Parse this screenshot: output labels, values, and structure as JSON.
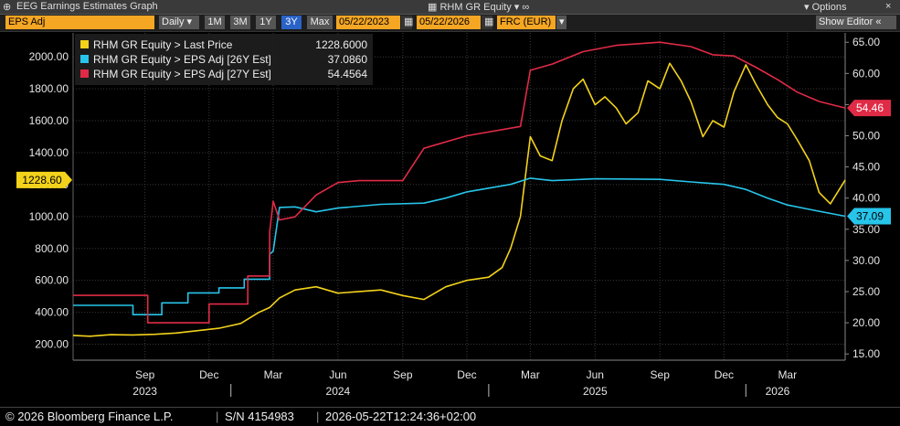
{
  "window": {
    "title": "EEG Earnings Estimates Graph",
    "security_label": "RHM GR Equity",
    "options_label": "Options",
    "close_glyph": "×"
  },
  "toolbar": {
    "field": "EPS Adj",
    "period": "Daily",
    "ranges": [
      "1M",
      "3M",
      "1Y",
      "3Y",
      "Max"
    ],
    "active_range": "3Y",
    "start_date": "05/22/2023",
    "end_date": "05/22/2026",
    "currency": "FRC (EUR)",
    "show_editor": "Show Editor"
  },
  "footer": {
    "copyright": "© 2026 Bloomberg Finance L.P.",
    "serial": "S/N 4154983",
    "timestamp": "2026-05-22T12:24:36+02:00"
  },
  "colors": {
    "price": "#f2d21b",
    "eps26": "#27c5ea",
    "eps27": "#e02b46",
    "grid": "#3a3a3a",
    "axis_text": "#e6e6e6"
  },
  "chart_data": {
    "type": "line",
    "legend": [
      {
        "label": "RHM GR Equity > Last Price",
        "value": "1228.6000",
        "color": "#f2d21b"
      },
      {
        "label": "RHM GR Equity > EPS Adj [26Y Est]",
        "value": "37.0860",
        "color": "#27c5ea"
      },
      {
        "label": "RHM GR Equity > EPS Adj [27Y Est]",
        "value": "54.4564",
        "color": "#e02b46"
      }
    ],
    "legend_position": "top-left",
    "left_axis": {
      "range": [
        100,
        2150
      ],
      "ticks": [
        "200.00",
        "400.00",
        "600.00",
        "800.00",
        "1000.00",
        "1200.00",
        "1400.00",
        "1600.00",
        "1800.00",
        "2000.00"
      ]
    },
    "right_axis": {
      "range": [
        14,
        66.5
      ],
      "ticks": [
        "15.00",
        "20.00",
        "25.00",
        "30.00",
        "35.00",
        "40.00",
        "45.00",
        "50.00",
        "55.00",
        "60.00",
        "65.00"
      ]
    },
    "x_axis": {
      "start": "2023-05-22",
      "end": "2026-05-22",
      "month_ticks": [
        {
          "date": "2023-09-01",
          "label": "Sep"
        },
        {
          "date": "2023-12-01",
          "label": "Dec"
        },
        {
          "date": "2024-03-01",
          "label": "Mar"
        },
        {
          "date": "2024-06-01",
          "label": "Jun"
        },
        {
          "date": "2024-09-01",
          "label": "Sep"
        },
        {
          "date": "2024-12-01",
          "label": "Dec"
        },
        {
          "date": "2025-03-01",
          "label": "Mar"
        },
        {
          "date": "2025-06-01",
          "label": "Jun"
        },
        {
          "date": "2025-09-01",
          "label": "Sep"
        },
        {
          "date": "2025-12-01",
          "label": "Dec"
        },
        {
          "date": "2026-03-01",
          "label": "Mar"
        }
      ],
      "year_labels": [
        {
          "date": "2023-09-01",
          "label": "2023"
        },
        {
          "date": "2024-06-01",
          "label": "2024"
        },
        {
          "date": "2025-06-01",
          "label": "2025"
        },
        {
          "date": "2026-02-15",
          "label": "2026"
        }
      ],
      "year_separators": [
        "2024-01-01",
        "2025-01-01",
        "2026-01-01"
      ]
    },
    "grid": true,
    "series": [
      {
        "name": "RHM GR Equity > Last Price",
        "axis": "left",
        "color": "#f2d21b",
        "last_label": "1228.60",
        "points": [
          [
            "2023-05-22",
            255
          ],
          [
            "2023-06-15",
            250
          ],
          [
            "2023-07-15",
            260
          ],
          [
            "2023-08-15",
            258
          ],
          [
            "2023-09-15",
            262
          ],
          [
            "2023-10-15",
            270
          ],
          [
            "2023-11-15",
            285
          ],
          [
            "2023-12-15",
            300
          ],
          [
            "2024-01-15",
            330
          ],
          [
            "2024-02-10",
            400
          ],
          [
            "2024-02-25",
            430
          ],
          [
            "2024-03-10",
            490
          ],
          [
            "2024-04-01",
            540
          ],
          [
            "2024-05-01",
            560
          ],
          [
            "2024-06-01",
            520
          ],
          [
            "2024-07-01",
            530
          ],
          [
            "2024-08-01",
            540
          ],
          [
            "2024-09-01",
            505
          ],
          [
            "2024-10-01",
            480
          ],
          [
            "2024-11-01",
            560
          ],
          [
            "2024-12-01",
            600
          ],
          [
            "2025-01-01",
            620
          ],
          [
            "2025-01-20",
            680
          ],
          [
            "2025-02-01",
            800
          ],
          [
            "2025-02-15",
            1000
          ],
          [
            "2025-03-01",
            1500
          ],
          [
            "2025-03-15",
            1380
          ],
          [
            "2025-04-01",
            1350
          ],
          [
            "2025-04-15",
            1600
          ],
          [
            "2025-05-01",
            1800
          ],
          [
            "2025-05-15",
            1860
          ],
          [
            "2025-06-01",
            1700
          ],
          [
            "2025-06-15",
            1750
          ],
          [
            "2025-07-01",
            1680
          ],
          [
            "2025-07-15",
            1580
          ],
          [
            "2025-08-01",
            1650
          ],
          [
            "2025-08-15",
            1850
          ],
          [
            "2025-09-01",
            1800
          ],
          [
            "2025-09-15",
            1960
          ],
          [
            "2025-10-01",
            1850
          ],
          [
            "2025-10-15",
            1720
          ],
          [
            "2025-11-01",
            1500
          ],
          [
            "2025-11-15",
            1600
          ],
          [
            "2025-12-01",
            1560
          ],
          [
            "2025-12-15",
            1780
          ],
          [
            "2026-01-01",
            1950
          ],
          [
            "2026-01-15",
            1830
          ],
          [
            "2026-02-01",
            1700
          ],
          [
            "2026-02-15",
            1620
          ],
          [
            "2026-03-01",
            1580
          ],
          [
            "2026-03-15",
            1480
          ],
          [
            "2026-04-01",
            1350
          ],
          [
            "2026-04-15",
            1150
          ],
          [
            "2026-05-01",
            1080
          ],
          [
            "2026-05-22",
            1228.6
          ]
        ]
      },
      {
        "name": "RHM GR Equity > EPS Adj [26Y Est]",
        "axis": "right",
        "color": "#27c5ea",
        "last_label": "37.09",
        "points": [
          [
            "2023-05-22",
            22.8
          ],
          [
            "2023-08-15",
            22.8
          ],
          [
            "2023-08-15",
            21.3
          ],
          [
            "2023-09-25",
            21.3
          ],
          [
            "2023-09-25",
            23.2
          ],
          [
            "2023-11-01",
            23.2
          ],
          [
            "2023-11-01",
            24.8
          ],
          [
            "2023-12-15",
            24.8
          ],
          [
            "2023-12-15",
            25.6
          ],
          [
            "2024-01-20",
            25.6
          ],
          [
            "2024-01-20",
            27.0
          ],
          [
            "2024-02-25",
            27.0
          ],
          [
            "2024-02-25",
            31.0
          ],
          [
            "2024-03-01",
            31.5
          ],
          [
            "2024-03-10",
            38.5
          ],
          [
            "2024-04-01",
            38.6
          ],
          [
            "2024-05-01",
            37.8
          ],
          [
            "2024-06-01",
            38.4
          ],
          [
            "2024-08-01",
            39.0
          ],
          [
            "2024-10-01",
            39.2
          ],
          [
            "2024-11-01",
            40.0
          ],
          [
            "2024-12-01",
            41.0
          ],
          [
            "2025-01-01",
            41.6
          ],
          [
            "2025-02-01",
            42.2
          ],
          [
            "2025-03-01",
            43.2
          ],
          [
            "2025-04-01",
            42.8
          ],
          [
            "2025-06-01",
            43.1
          ],
          [
            "2025-09-01",
            43.0
          ],
          [
            "2025-10-15",
            42.6
          ],
          [
            "2025-12-01",
            42.2
          ],
          [
            "2026-01-01",
            41.4
          ],
          [
            "2026-02-01",
            40.0
          ],
          [
            "2026-03-01",
            38.9
          ],
          [
            "2026-04-01",
            38.2
          ],
          [
            "2026-05-22",
            37.09
          ]
        ]
      },
      {
        "name": "RHM GR Equity > EPS Adj [27Y Est]",
        "axis": "right",
        "color": "#e02b46",
        "last_label": "54.46",
        "points": [
          [
            "2023-05-22",
            24.4
          ],
          [
            "2023-09-05",
            24.4
          ],
          [
            "2023-09-05",
            20.0
          ],
          [
            "2023-12-01",
            20.0
          ],
          [
            "2023-12-01",
            23.0
          ],
          [
            "2024-01-25",
            23.0
          ],
          [
            "2024-01-25",
            27.5
          ],
          [
            "2024-02-25",
            27.5
          ],
          [
            "2024-02-25",
            34.5
          ],
          [
            "2024-03-01",
            39.5
          ],
          [
            "2024-03-10",
            36.5
          ],
          [
            "2024-04-01",
            37.0
          ],
          [
            "2024-05-01",
            40.5
          ],
          [
            "2024-06-01",
            42.5
          ],
          [
            "2024-07-01",
            42.8
          ],
          [
            "2024-09-01",
            42.8
          ],
          [
            "2024-10-01",
            48.0
          ],
          [
            "2024-12-01",
            50.0
          ],
          [
            "2025-02-15",
            51.5
          ],
          [
            "2025-03-01",
            60.5
          ],
          [
            "2025-04-01",
            61.5
          ],
          [
            "2025-05-15",
            63.5
          ],
          [
            "2025-07-01",
            64.5
          ],
          [
            "2025-09-01",
            65.0
          ],
          [
            "2025-10-15",
            64.3
          ],
          [
            "2025-11-15",
            63.0
          ],
          [
            "2025-12-15",
            62.8
          ],
          [
            "2026-01-15",
            61.0
          ],
          [
            "2026-02-15",
            59.0
          ],
          [
            "2026-03-15",
            57.0
          ],
          [
            "2026-04-15",
            55.5
          ],
          [
            "2026-05-22",
            54.46
          ]
        ]
      }
    ]
  }
}
